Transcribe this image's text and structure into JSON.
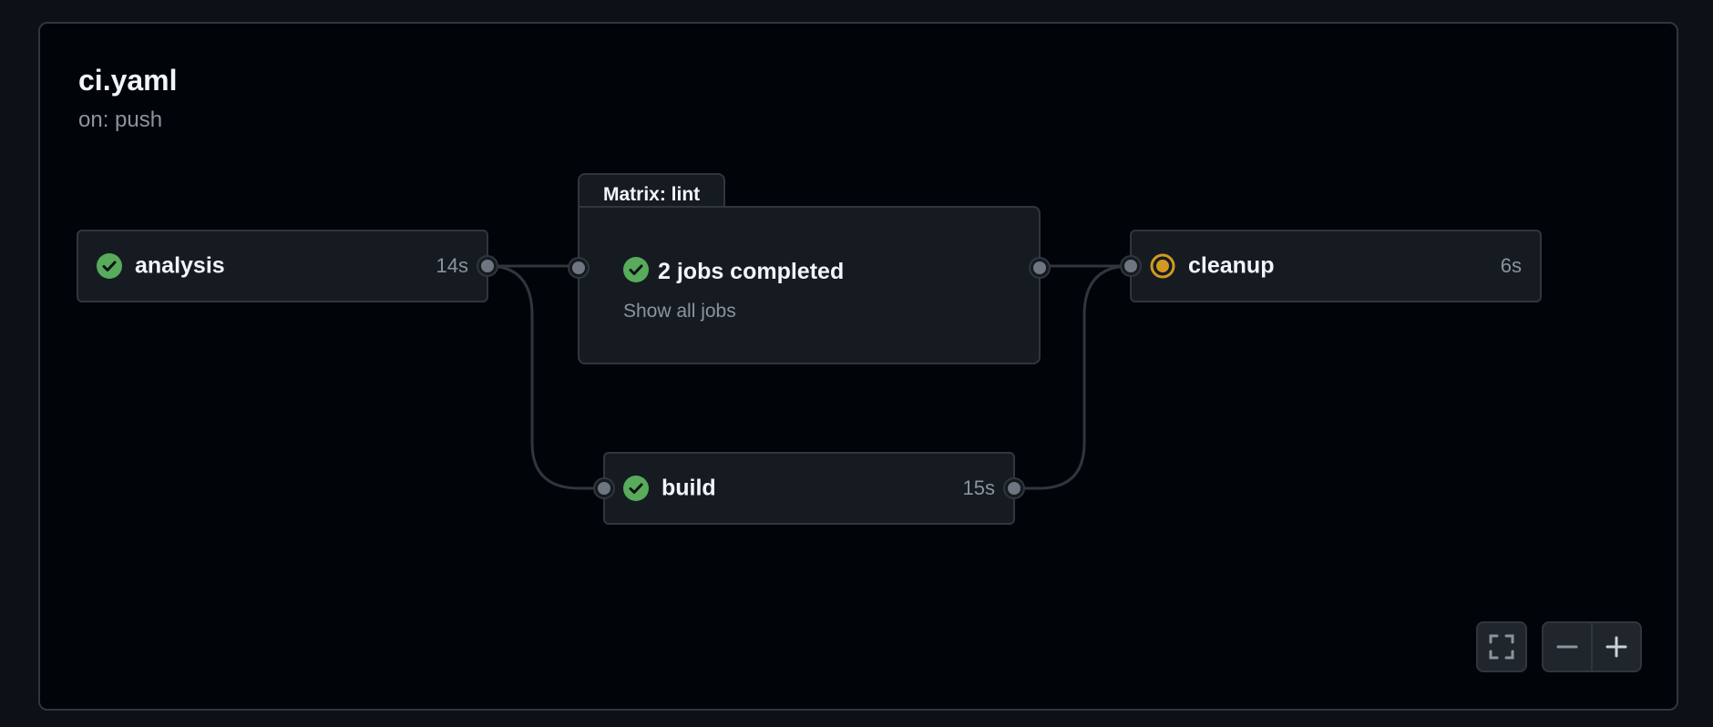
{
  "workflow": {
    "title": "ci.yaml",
    "trigger": "on: push"
  },
  "jobs": {
    "analysis": {
      "name": "analysis",
      "duration": "14s",
      "status": "success",
      "status_icon": "check-circle-icon"
    },
    "build": {
      "name": "build",
      "duration": "15s",
      "status": "success",
      "status_icon": "check-circle-icon"
    },
    "cleanup": {
      "name": "cleanup",
      "duration": "6s",
      "status": "in-progress",
      "status_icon": "in-progress-icon"
    }
  },
  "matrix": {
    "label": "Matrix: lint",
    "summary": "2 jobs completed",
    "status_icon": "check-circle-icon",
    "show_all": "Show all jobs"
  },
  "controls": {
    "fullscreen_icon": "fullscreen-icon",
    "zoom_out_icon": "minus-icon",
    "zoom_in_icon": "plus-icon"
  },
  "colors": {
    "success": "#57ab5a",
    "in_progress": "#d29922",
    "background": "#010409",
    "card": "#161b22",
    "border": "#30363d",
    "muted_text": "#8b949e"
  }
}
